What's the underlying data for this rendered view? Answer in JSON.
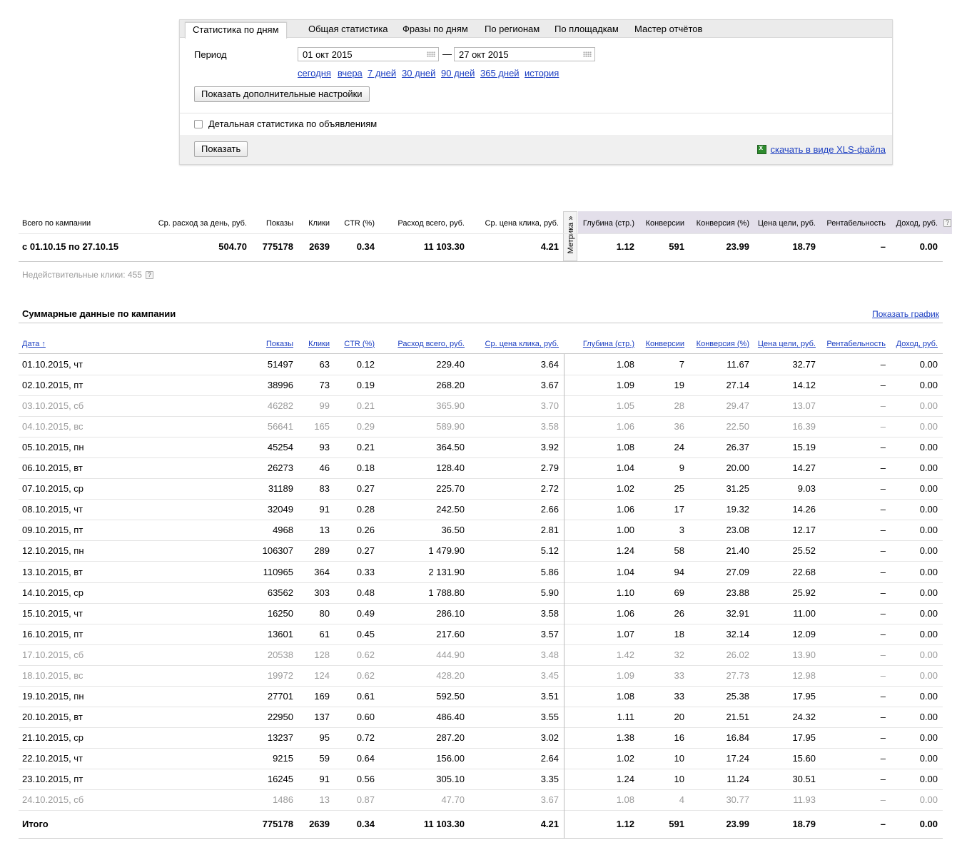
{
  "tabs": [
    "Статистика по дням",
    "Общая статистика",
    "Фразы по дням",
    "По регионам",
    "По площадкам",
    "Мастер отчётов"
  ],
  "filter": {
    "period_label": "Период",
    "date_from": "01 окт 2015",
    "date_to": "27 окт 2015",
    "dash": "—",
    "quick_links": [
      "сегодня",
      "вчера",
      "7 дней",
      "30 дней",
      "90 дней",
      "365 дней",
      "история"
    ],
    "more_settings": "Показать дополнительные настройки",
    "detail_checkbox_label": "Детальная статистика по объявлениям",
    "detail_checked": false,
    "show_button": "Показать",
    "xls_link": "скачать в виде XLS-файла"
  },
  "summary": {
    "headers": [
      "Всего по кампании",
      "Ср. расход за день, руб.",
      "Показы",
      "Клики",
      "CTR (%)",
      "Расход всего, руб.",
      "Ср. цена клика, руб.",
      "Глубина (стр.)",
      "Конверсии",
      "Конверсия (%)",
      "Цена цели, руб.",
      "Рентабельность",
      "Доход, руб."
    ],
    "metrika_tab": "Метрика »",
    "help": "?",
    "row": [
      "с 01.10.15 по 27.10.15",
      "504.70",
      "775178",
      "2639",
      "0.34",
      "11 103.30",
      "4.21",
      "1.12",
      "591",
      "23.99",
      "18.79",
      "–",
      "0.00"
    ],
    "invalid_clicks": "Недействительные клики: 455"
  },
  "daily": {
    "title": "Суммарные данные по кампании",
    "show_chart": "Показать график",
    "headers": [
      "Дата ↑",
      "Показы",
      "Клики",
      "CTR (%)",
      "Расход всего, руб.",
      "Ср. цена клика, руб.",
      "Глубина (стр.)",
      "Конверсии",
      "Конверсия (%)",
      "Цена цели, руб.",
      "Рентабельность",
      "Доход, руб."
    ],
    "rows": [
      {
        "c": [
          "01.10.2015, чт",
          "51497",
          "63",
          "0.12",
          "229.40",
          "3.64",
          "1.08",
          "7",
          "11.67",
          "32.77",
          "–",
          "0.00"
        ],
        "weekend": false
      },
      {
        "c": [
          "02.10.2015, пт",
          "38996",
          "73",
          "0.19",
          "268.20",
          "3.67",
          "1.09",
          "19",
          "27.14",
          "14.12",
          "–",
          "0.00"
        ],
        "weekend": false
      },
      {
        "c": [
          "03.10.2015, сб",
          "46282",
          "99",
          "0.21",
          "365.90",
          "3.70",
          "1.05",
          "28",
          "29.47",
          "13.07",
          "–",
          "0.00"
        ],
        "weekend": true
      },
      {
        "c": [
          "04.10.2015, вс",
          "56641",
          "165",
          "0.29",
          "589.90",
          "3.58",
          "1.06",
          "36",
          "22.50",
          "16.39",
          "–",
          "0.00"
        ],
        "weekend": true
      },
      {
        "c": [
          "05.10.2015, пн",
          "45254",
          "93",
          "0.21",
          "364.50",
          "3.92",
          "1.08",
          "24",
          "26.37",
          "15.19",
          "–",
          "0.00"
        ],
        "weekend": false
      },
      {
        "c": [
          "06.10.2015, вт",
          "26273",
          "46",
          "0.18",
          "128.40",
          "2.79",
          "1.04",
          "9",
          "20.00",
          "14.27",
          "–",
          "0.00"
        ],
        "weekend": false
      },
      {
        "c": [
          "07.10.2015, ср",
          "31189",
          "83",
          "0.27",
          "225.70",
          "2.72",
          "1.02",
          "25",
          "31.25",
          "9.03",
          "–",
          "0.00"
        ],
        "weekend": false
      },
      {
        "c": [
          "08.10.2015, чт",
          "32049",
          "91",
          "0.28",
          "242.50",
          "2.66",
          "1.06",
          "17",
          "19.32",
          "14.26",
          "–",
          "0.00"
        ],
        "weekend": false
      },
      {
        "c": [
          "09.10.2015, пт",
          "4968",
          "13",
          "0.26",
          "36.50",
          "2.81",
          "1.00",
          "3",
          "23.08",
          "12.17",
          "–",
          "0.00"
        ],
        "weekend": false
      },
      {
        "c": [
          "12.10.2015, пн",
          "106307",
          "289",
          "0.27",
          "1 479.90",
          "5.12",
          "1.24",
          "58",
          "21.40",
          "25.52",
          "–",
          "0.00"
        ],
        "weekend": false
      },
      {
        "c": [
          "13.10.2015, вт",
          "110965",
          "364",
          "0.33",
          "2 131.90",
          "5.86",
          "1.04",
          "94",
          "27.09",
          "22.68",
          "–",
          "0.00"
        ],
        "weekend": false
      },
      {
        "c": [
          "14.10.2015, ср",
          "63562",
          "303",
          "0.48",
          "1 788.80",
          "5.90",
          "1.10",
          "69",
          "23.88",
          "25.92",
          "–",
          "0.00"
        ],
        "weekend": false
      },
      {
        "c": [
          "15.10.2015, чт",
          "16250",
          "80",
          "0.49",
          "286.10",
          "3.58",
          "1.06",
          "26",
          "32.91",
          "11.00",
          "–",
          "0.00"
        ],
        "weekend": false
      },
      {
        "c": [
          "16.10.2015, пт",
          "13601",
          "61",
          "0.45",
          "217.60",
          "3.57",
          "1.07",
          "18",
          "32.14",
          "12.09",
          "–",
          "0.00"
        ],
        "weekend": false
      },
      {
        "c": [
          "17.10.2015, сб",
          "20538",
          "128",
          "0.62",
          "444.90",
          "3.48",
          "1.42",
          "32",
          "26.02",
          "13.90",
          "–",
          "0.00"
        ],
        "weekend": true
      },
      {
        "c": [
          "18.10.2015, вс",
          "19972",
          "124",
          "0.62",
          "428.20",
          "3.45",
          "1.09",
          "33",
          "27.73",
          "12.98",
          "–",
          "0.00"
        ],
        "weekend": true
      },
      {
        "c": [
          "19.10.2015, пн",
          "27701",
          "169",
          "0.61",
          "592.50",
          "3.51",
          "1.08",
          "33",
          "25.38",
          "17.95",
          "–",
          "0.00"
        ],
        "weekend": false
      },
      {
        "c": [
          "20.10.2015, вт",
          "22950",
          "137",
          "0.60",
          "486.40",
          "3.55",
          "1.11",
          "20",
          "21.51",
          "24.32",
          "–",
          "0.00"
        ],
        "weekend": false
      },
      {
        "c": [
          "21.10.2015, ср",
          "13237",
          "95",
          "0.72",
          "287.20",
          "3.02",
          "1.38",
          "16",
          "16.84",
          "17.95",
          "–",
          "0.00"
        ],
        "weekend": false
      },
      {
        "c": [
          "22.10.2015, чт",
          "9215",
          "59",
          "0.64",
          "156.00",
          "2.64",
          "1.02",
          "10",
          "17.24",
          "15.60",
          "–",
          "0.00"
        ],
        "weekend": false
      },
      {
        "c": [
          "23.10.2015, пт",
          "16245",
          "91",
          "0.56",
          "305.10",
          "3.35",
          "1.24",
          "10",
          "11.24",
          "30.51",
          "–",
          "0.00"
        ],
        "weekend": false
      },
      {
        "c": [
          "24.10.2015, сб",
          "1486",
          "13",
          "0.87",
          "47.70",
          "3.67",
          "1.08",
          "4",
          "30.77",
          "11.93",
          "–",
          "0.00"
        ],
        "weekend": true
      }
    ],
    "total": [
      "Итого",
      "775178",
      "2639",
      "0.34",
      "11 103.30",
      "4.21",
      "1.12",
      "591",
      "23.99",
      "18.79",
      "–",
      "0.00"
    ]
  }
}
